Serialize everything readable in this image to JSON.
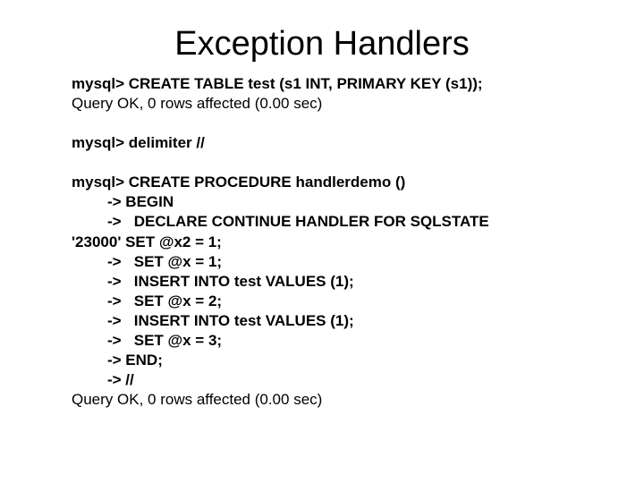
{
  "title": "Exception Handlers",
  "lines": {
    "l1": "mysql> CREATE TABLE test (s1 INT, PRIMARY KEY (s1));",
    "l2": "Query OK, 0 rows affected (0.00 sec)",
    "l3": "mysql> delimiter //",
    "l4": "mysql> CREATE PROCEDURE handlerdemo ()",
    "l5": "-> BEGIN",
    "l6": "->   DECLARE CONTINUE HANDLER FOR SQLSTATE",
    "l7": "'23000' SET @x2 = 1;",
    "l8": "->   SET @x = 1;",
    "l9": "->   INSERT INTO test VALUES (1);",
    "l10": "->   SET @x = 2;",
    "l11": "->   INSERT INTO test VALUES (1);",
    "l12": "->   SET @x = 3;",
    "l13": "-> END;",
    "l14": "-> //",
    "l15": "Query OK, 0 rows affected (0.00 sec)"
  }
}
